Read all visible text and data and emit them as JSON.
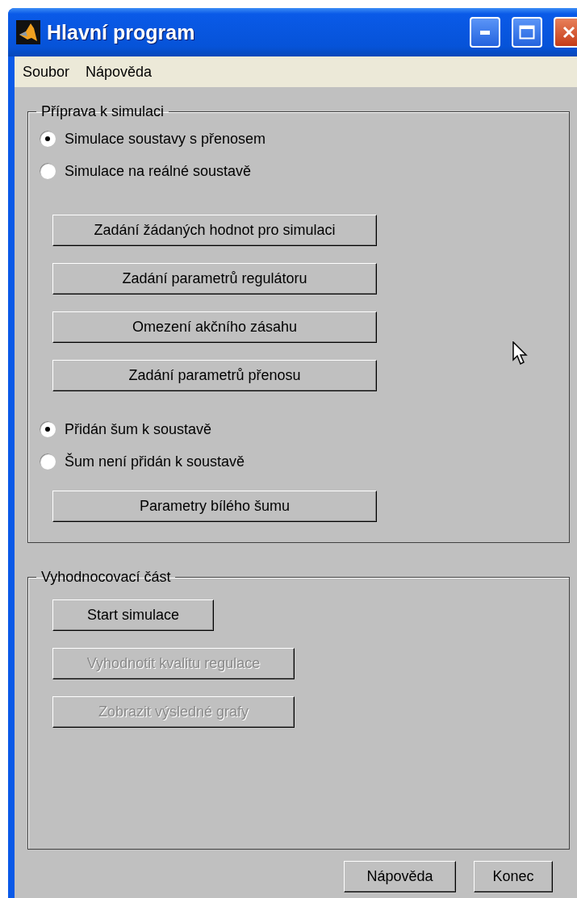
{
  "window": {
    "title": "Hlavní program"
  },
  "menu": [
    {
      "label": "Soubor"
    },
    {
      "label": "Nápověda"
    }
  ],
  "simulation_setup": {
    "title": "Příprava k simulaci",
    "plant_mode": [
      {
        "label": "Simulace soustavy s přenosem",
        "selected": true
      },
      {
        "label": "Simulace na reálné soustavě",
        "selected": false
      }
    ],
    "buttons": [
      {
        "label": "Zadání žádaných hodnot pro simulaci",
        "disabled": false
      },
      {
        "label": "Zadání parametrů regulátoru",
        "disabled": false
      },
      {
        "label": "Omezení akčního zásahu",
        "disabled": false
      },
      {
        "label": "Zadání parametrů přenosu",
        "disabled": false
      }
    ],
    "noise_mode": [
      {
        "label": "Přidán šum k soustavě",
        "selected": true
      },
      {
        "label": "Šum není přidán k soustavě",
        "selected": false
      }
    ],
    "noise_button": {
      "label": "Parametry bílého šumu",
      "disabled": false
    }
  },
  "evaluation": {
    "title": "Vyhodnocovací část",
    "buttons": [
      {
        "label": "Start simulace",
        "disabled": false
      },
      {
        "label": "Vyhodnotit kvalitu regulace",
        "disabled": true
      },
      {
        "label": "Zobrazit výsledné grafy",
        "disabled": true
      }
    ]
  },
  "footer_buttons": [
    {
      "label": "Nápověda",
      "disabled": false
    },
    {
      "label": "Konec",
      "disabled": false
    }
  ]
}
